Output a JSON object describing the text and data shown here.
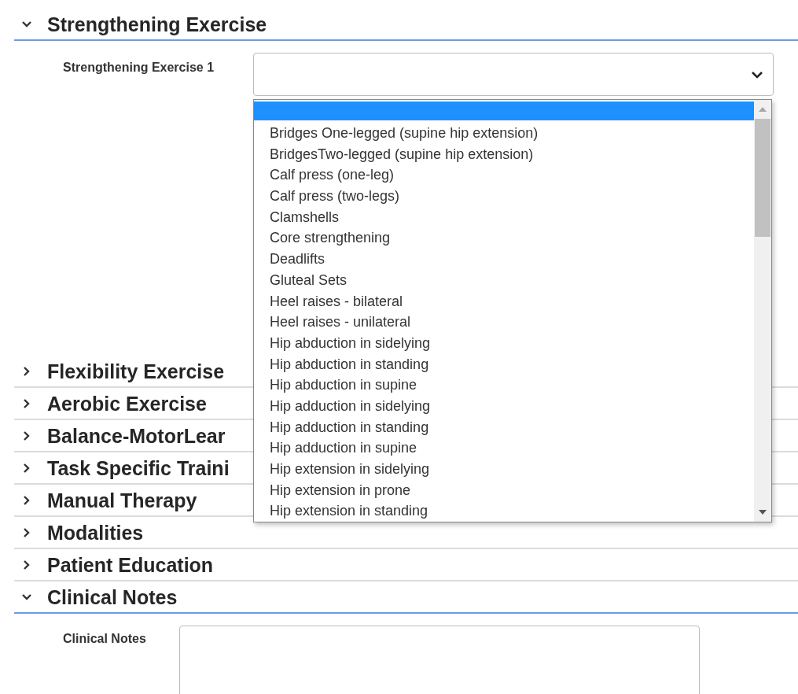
{
  "sections": [
    {
      "title": "Strengthening Exercise",
      "expanded": true,
      "field": {
        "kind": "select",
        "label": "Strengthening Exercise 1",
        "open": true,
        "options": [
          {
            "selected": true
          },
          {
            "label": "Bridges One-legged (supine hip extension)",
            "selected": false
          },
          {
            "label": "BridgesTwo-legged (supine hip extension)",
            "selected": false
          },
          {
            "label": "Calf press (one-leg)",
            "selected": false
          },
          {
            "label": "Calf press (two-legs)",
            "selected": false
          },
          {
            "label": "Clamshells",
            "selected": false
          },
          {
            "label": "Core strengthening",
            "selected": false
          },
          {
            "label": "Deadlifts",
            "selected": false
          },
          {
            "label": "Gluteal Sets",
            "selected": false
          },
          {
            "label": "Heel raises - bilateral",
            "selected": false
          },
          {
            "label": "Heel raises - unilateral",
            "selected": false
          },
          {
            "label": "Hip abduction in sidelying",
            "selected": false
          },
          {
            "label": "Hip abduction in standing",
            "selected": false
          },
          {
            "label": "Hip abduction in supine",
            "selected": false
          },
          {
            "label": "Hip adduction in sidelying",
            "selected": false
          },
          {
            "label": "Hip adduction in standing",
            "selected": false
          },
          {
            "label": "Hip adduction in supine",
            "selected": false
          },
          {
            "label": "Hip extension in sidelying",
            "selected": false
          },
          {
            "label": "Hip extension in prone",
            "selected": false
          },
          {
            "label": "Hip extension in standing",
            "selected": false
          }
        ]
      }
    },
    {
      "title": "Flexibility Exercise",
      "expanded": false
    },
    {
      "title": "Aerobic Exercise",
      "expanded": false
    },
    {
      "title": "Balance-MotorLear",
      "expanded": false
    },
    {
      "title": "Task Specific Traini",
      "expanded": false
    },
    {
      "title": "Manual Therapy",
      "expanded": false
    },
    {
      "title": "Modalities",
      "expanded": false
    },
    {
      "title": "Patient Education",
      "expanded": false
    },
    {
      "title": "Clinical Notes",
      "expanded": true,
      "field": {
        "kind": "textarea",
        "label": "Clinical Notes"
      }
    }
  ]
}
